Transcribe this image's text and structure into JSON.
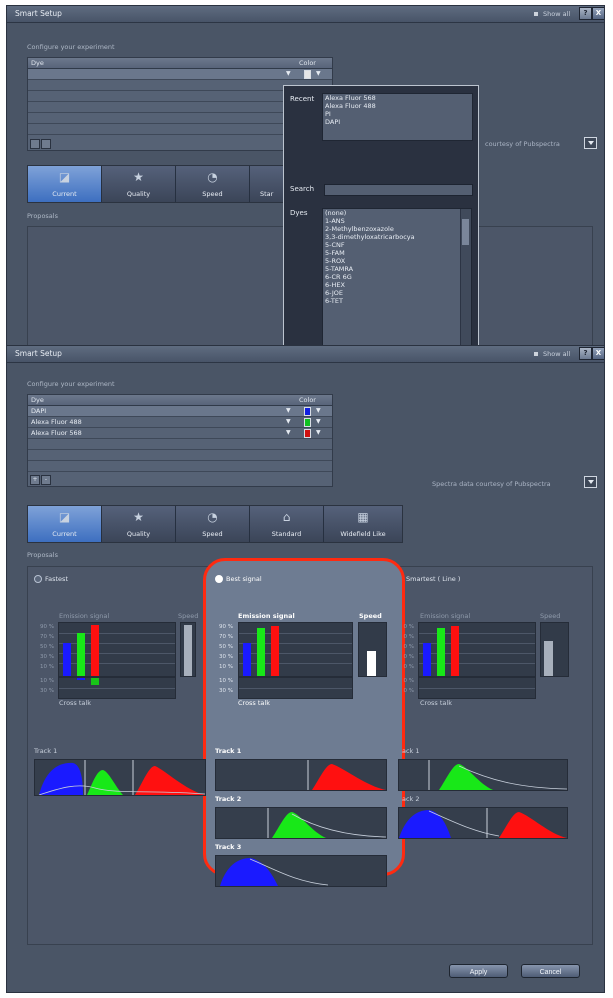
{
  "top_window": {
    "title": "Smart Setup",
    "show_all": "Show all",
    "help_btn": "?",
    "close_btn": "X",
    "section_label": "Configure your experiment",
    "table": {
      "col_dye": "Dye",
      "col_color": "Color"
    },
    "courtesy": "courtesy of Pubspectra",
    "proposals_label": "Proposals"
  },
  "popup": {
    "recent_label": "Recent",
    "recent_items": [
      "Alexa Fluor 568",
      "Alexa Fluor 488",
      "PI",
      "DAPI"
    ],
    "search_label": "Search",
    "search_value": "",
    "dyes_label": "Dyes",
    "dyes_items": [
      "(none)",
      "1-ANS",
      "2-Methylbenzoxazole",
      "3,3-dimethyloxatricarbocya",
      "5-CNF",
      "5-FAM",
      "5-ROX",
      "5-TAMRA",
      "6-CR 6G",
      "6-HEX",
      "6-JOE",
      "6-TET"
    ]
  },
  "main_window": {
    "title": "Smart Setup",
    "show_all": "Show all",
    "help_btn": "?",
    "close_btn": "X",
    "section_label": "Configure your experiment",
    "table": {
      "col_dye": "Dye",
      "col_color": "Color",
      "rows": [
        {
          "name": "DAPI",
          "color": "#1020e0"
        },
        {
          "name": "Alexa Fluor 488",
          "color": "#10c020"
        },
        {
          "name": "Alexa Fluor 568",
          "color": "#d01010"
        }
      ]
    },
    "add_btn": "+",
    "remove_btn": "-",
    "courtesy": "Spectra data courtesy of Pubspectra",
    "tabs": [
      "Current",
      "Quality",
      "Speed",
      "Standard",
      "Widefield Like"
    ],
    "proposals_label": "Proposals",
    "proposals": {
      "fastest": {
        "title": "Fastest",
        "emission_label": "Emission signal",
        "speed_label": "Speed",
        "crosstalk_label": "Cross talk",
        "y_labels": [
          "90 %",
          "70 %",
          "50 %",
          "30 %",
          "10 %"
        ],
        "ct_labels": [
          "10 %",
          "30 %"
        ],
        "tracks": [
          "Track 1"
        ]
      },
      "best": {
        "title": "Best signal",
        "emission_label": "Emission signal",
        "speed_label": "Speed",
        "crosstalk_label": "Cross talk",
        "y_labels": [
          "90 %",
          "70 %",
          "50 %",
          "30 %",
          "10 %"
        ],
        "ct_labels": [
          "10 %",
          "30 %"
        ],
        "tracks": [
          "Track 1",
          "Track 2",
          "Track 3"
        ]
      },
      "smartest": {
        "title": "Smartest ( Line )",
        "emission_label": "Emission signal",
        "speed_label": "Speed",
        "crosstalk_label": "Cross talk",
        "y_labels": [
          "0 %",
          "0 %",
          "0 %",
          "0 %",
          "0 %"
        ],
        "ct_labels": [
          "0 %",
          "0 %"
        ],
        "tracks": [
          "ack 1",
          "ack 2"
        ]
      }
    },
    "apply_btn": "Apply",
    "cancel_btn": "Cancel"
  },
  "colors": {
    "blue": "#1a1aff",
    "green": "#18e818",
    "red": "#ff1010",
    "highlight": "#ff2a10"
  }
}
